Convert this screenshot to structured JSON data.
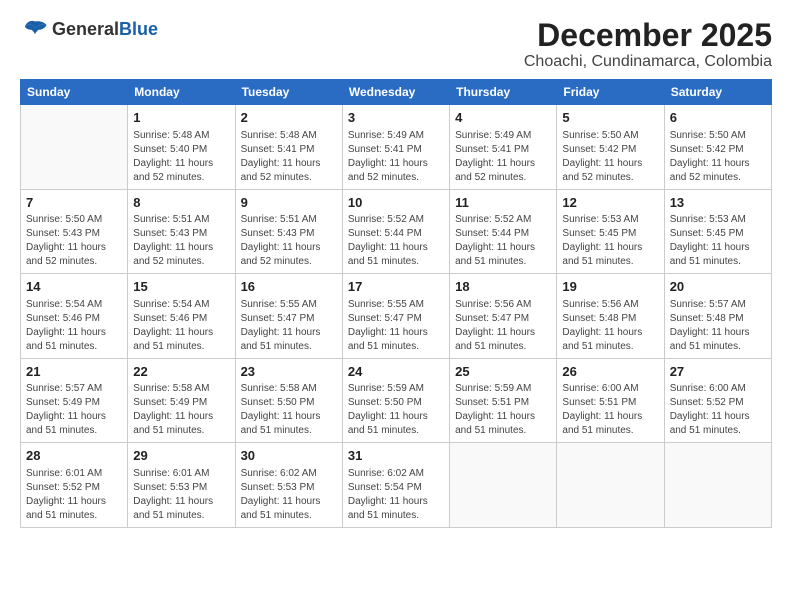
{
  "header": {
    "logo_general": "General",
    "logo_blue": "Blue",
    "main_title": "December 2025",
    "subtitle": "Choachi, Cundinamarca, Colombia"
  },
  "calendar": {
    "days_of_week": [
      "Sunday",
      "Monday",
      "Tuesday",
      "Wednesday",
      "Thursday",
      "Friday",
      "Saturday"
    ],
    "weeks": [
      [
        {
          "day": "",
          "info": ""
        },
        {
          "day": "1",
          "info": "Sunrise: 5:48 AM\nSunset: 5:40 PM\nDaylight: 11 hours\nand 52 minutes."
        },
        {
          "day": "2",
          "info": "Sunrise: 5:48 AM\nSunset: 5:41 PM\nDaylight: 11 hours\nand 52 minutes."
        },
        {
          "day": "3",
          "info": "Sunrise: 5:49 AM\nSunset: 5:41 PM\nDaylight: 11 hours\nand 52 minutes."
        },
        {
          "day": "4",
          "info": "Sunrise: 5:49 AM\nSunset: 5:41 PM\nDaylight: 11 hours\nand 52 minutes."
        },
        {
          "day": "5",
          "info": "Sunrise: 5:50 AM\nSunset: 5:42 PM\nDaylight: 11 hours\nand 52 minutes."
        },
        {
          "day": "6",
          "info": "Sunrise: 5:50 AM\nSunset: 5:42 PM\nDaylight: 11 hours\nand 52 minutes."
        }
      ],
      [
        {
          "day": "7",
          "info": "Sunrise: 5:50 AM\nSunset: 5:43 PM\nDaylight: 11 hours\nand 52 minutes."
        },
        {
          "day": "8",
          "info": "Sunrise: 5:51 AM\nSunset: 5:43 PM\nDaylight: 11 hours\nand 52 minutes."
        },
        {
          "day": "9",
          "info": "Sunrise: 5:51 AM\nSunset: 5:43 PM\nDaylight: 11 hours\nand 52 minutes."
        },
        {
          "day": "10",
          "info": "Sunrise: 5:52 AM\nSunset: 5:44 PM\nDaylight: 11 hours\nand 51 minutes."
        },
        {
          "day": "11",
          "info": "Sunrise: 5:52 AM\nSunset: 5:44 PM\nDaylight: 11 hours\nand 51 minutes."
        },
        {
          "day": "12",
          "info": "Sunrise: 5:53 AM\nSunset: 5:45 PM\nDaylight: 11 hours\nand 51 minutes."
        },
        {
          "day": "13",
          "info": "Sunrise: 5:53 AM\nSunset: 5:45 PM\nDaylight: 11 hours\nand 51 minutes."
        }
      ],
      [
        {
          "day": "14",
          "info": "Sunrise: 5:54 AM\nSunset: 5:46 PM\nDaylight: 11 hours\nand 51 minutes."
        },
        {
          "day": "15",
          "info": "Sunrise: 5:54 AM\nSunset: 5:46 PM\nDaylight: 11 hours\nand 51 minutes."
        },
        {
          "day": "16",
          "info": "Sunrise: 5:55 AM\nSunset: 5:47 PM\nDaylight: 11 hours\nand 51 minutes."
        },
        {
          "day": "17",
          "info": "Sunrise: 5:55 AM\nSunset: 5:47 PM\nDaylight: 11 hours\nand 51 minutes."
        },
        {
          "day": "18",
          "info": "Sunrise: 5:56 AM\nSunset: 5:47 PM\nDaylight: 11 hours\nand 51 minutes."
        },
        {
          "day": "19",
          "info": "Sunrise: 5:56 AM\nSunset: 5:48 PM\nDaylight: 11 hours\nand 51 minutes."
        },
        {
          "day": "20",
          "info": "Sunrise: 5:57 AM\nSunset: 5:48 PM\nDaylight: 11 hours\nand 51 minutes."
        }
      ],
      [
        {
          "day": "21",
          "info": "Sunrise: 5:57 AM\nSunset: 5:49 PM\nDaylight: 11 hours\nand 51 minutes."
        },
        {
          "day": "22",
          "info": "Sunrise: 5:58 AM\nSunset: 5:49 PM\nDaylight: 11 hours\nand 51 minutes."
        },
        {
          "day": "23",
          "info": "Sunrise: 5:58 AM\nSunset: 5:50 PM\nDaylight: 11 hours\nand 51 minutes."
        },
        {
          "day": "24",
          "info": "Sunrise: 5:59 AM\nSunset: 5:50 PM\nDaylight: 11 hours\nand 51 minutes."
        },
        {
          "day": "25",
          "info": "Sunrise: 5:59 AM\nSunset: 5:51 PM\nDaylight: 11 hours\nand 51 minutes."
        },
        {
          "day": "26",
          "info": "Sunrise: 6:00 AM\nSunset: 5:51 PM\nDaylight: 11 hours\nand 51 minutes."
        },
        {
          "day": "27",
          "info": "Sunrise: 6:00 AM\nSunset: 5:52 PM\nDaylight: 11 hours\nand 51 minutes."
        }
      ],
      [
        {
          "day": "28",
          "info": "Sunrise: 6:01 AM\nSunset: 5:52 PM\nDaylight: 11 hours\nand 51 minutes."
        },
        {
          "day": "29",
          "info": "Sunrise: 6:01 AM\nSunset: 5:53 PM\nDaylight: 11 hours\nand 51 minutes."
        },
        {
          "day": "30",
          "info": "Sunrise: 6:02 AM\nSunset: 5:53 PM\nDaylight: 11 hours\nand 51 minutes."
        },
        {
          "day": "31",
          "info": "Sunrise: 6:02 AM\nSunset: 5:54 PM\nDaylight: 11 hours\nand 51 minutes."
        },
        {
          "day": "",
          "info": ""
        },
        {
          "day": "",
          "info": ""
        },
        {
          "day": "",
          "info": ""
        }
      ]
    ]
  }
}
